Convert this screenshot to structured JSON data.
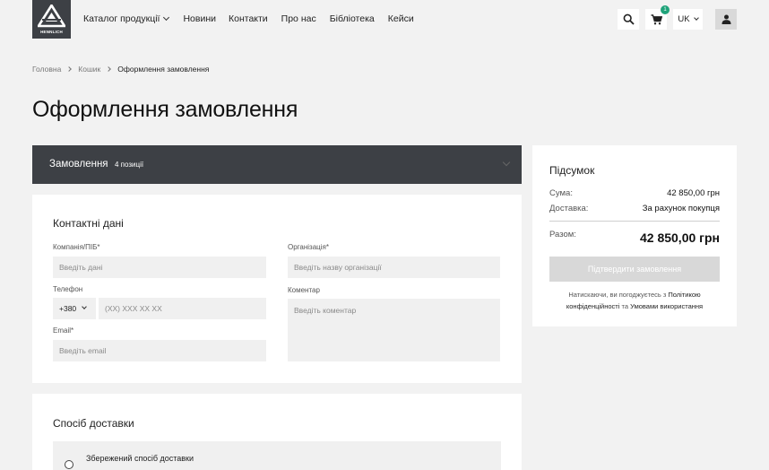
{
  "brand": {
    "logo_text": "HENNLICH"
  },
  "nav": {
    "items": [
      {
        "label": "Каталог продукції"
      },
      {
        "label": "Новини"
      },
      {
        "label": "Контакти"
      },
      {
        "label": "Про нас"
      },
      {
        "label": "Бібліотека"
      },
      {
        "label": "Кейси"
      }
    ]
  },
  "header": {
    "cart_count": "1",
    "language": "UK"
  },
  "breadcrumbs": [
    "Головна",
    "Кошик",
    "Оформлення замовлення"
  ],
  "page": {
    "title": "Оформлення замовлення"
  },
  "order": {
    "title": "Замовлення",
    "count": "4 позиції"
  },
  "contacts": {
    "title": "Контактні дані",
    "company_label": "Компанія/ПІБ*",
    "company_placeholder": "Введіть дані",
    "org_label": "Організація*",
    "org_placeholder": "Введіть назву організації",
    "phone_label": "Телефон",
    "phone_code": "+380",
    "phone_placeholder": "(XX) XXX XX XX",
    "comment_label": "Коментар",
    "comment_placeholder": "Введіть коментар",
    "email_label": "Email*",
    "email_placeholder": "Введіть email"
  },
  "delivery": {
    "title": "Спосіб доставки",
    "saved_label": "Збережений спосіб доставки"
  },
  "summary": {
    "title": "Підсумок",
    "sum_label": "Сума:",
    "sum_value": "42 850,00 грн",
    "delivery_label": "Доставка:",
    "delivery_value": "За рахунок покупця",
    "total_label": "Разом:",
    "total_value": "42 850,00 грн",
    "confirm_label": "Підтвердити замовлення",
    "terms_prefix": "Натискаючи, ви погоджуєтесь з",
    "privacy_link": "Політикою конфіденційності",
    "terms_and": "та",
    "terms_link": "Умовами використання"
  },
  "colors": {
    "dark": "#3d4045",
    "badge": "#1fa37a",
    "background": "#f2f2f2"
  }
}
